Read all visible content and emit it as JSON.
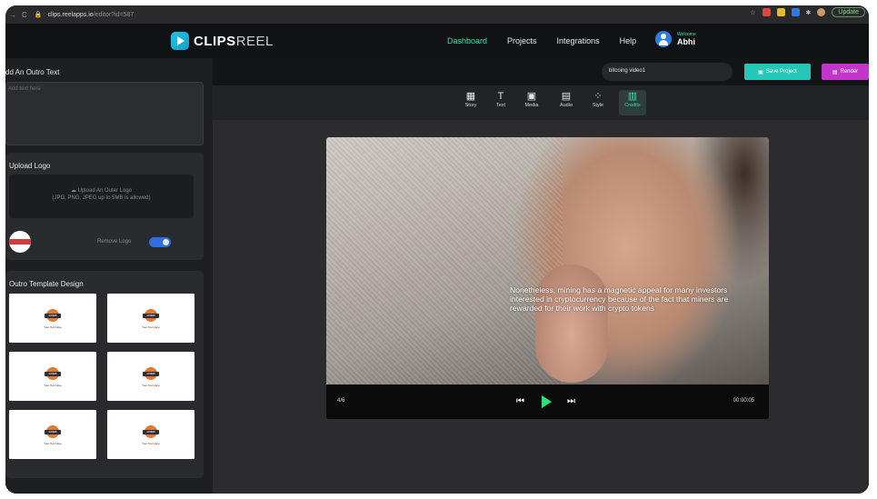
{
  "browser": {
    "url_host": "clips.reelapps.io",
    "url_path": "/editor?id=587",
    "update_label": "Update"
  },
  "header": {
    "logo_main": "CLIPS",
    "logo_accent": "REEL",
    "nav": [
      "Dashboard",
      "Projects",
      "Integrations",
      "Help"
    ],
    "welcome": "Welcome",
    "username": "Abhi"
  },
  "sidebar": {
    "outro_title": "dd An Outro Text",
    "outro_placeholder": "Add text here",
    "upload_title": "Upload Logo",
    "upload_line1": "Upload An Outer Logo",
    "upload_line2": "(JPG, PNG, JPEG up to 5MB is allowed)",
    "remove_logo_label": "Remove Logo",
    "remove_logo_on": true,
    "template_title": "Outro Template Design",
    "template_logo_word": "LOGO",
    "template_caption": "Your Text Here"
  },
  "project": {
    "name": "bitcoing video1",
    "save_label": "Save Project",
    "render_label": "Render"
  },
  "tools": [
    "Story",
    "Text",
    "Media",
    "Audio",
    "Style",
    "Credits"
  ],
  "active_tool": "Credits",
  "player": {
    "subtitle": "Nonetheless, mining has a magnetic appeal for many investors interested in cryptocurrency because of the fact that miners are rewarded for their work with crypto tokens",
    "slide_counter": "4/6",
    "timecode": "00:00:05"
  },
  "colors": {
    "accent_teal": "#25c8b8",
    "accent_green": "#2ee07a",
    "render_magenta": "#c236c9",
    "toggle_blue": "#2f6fe0"
  }
}
